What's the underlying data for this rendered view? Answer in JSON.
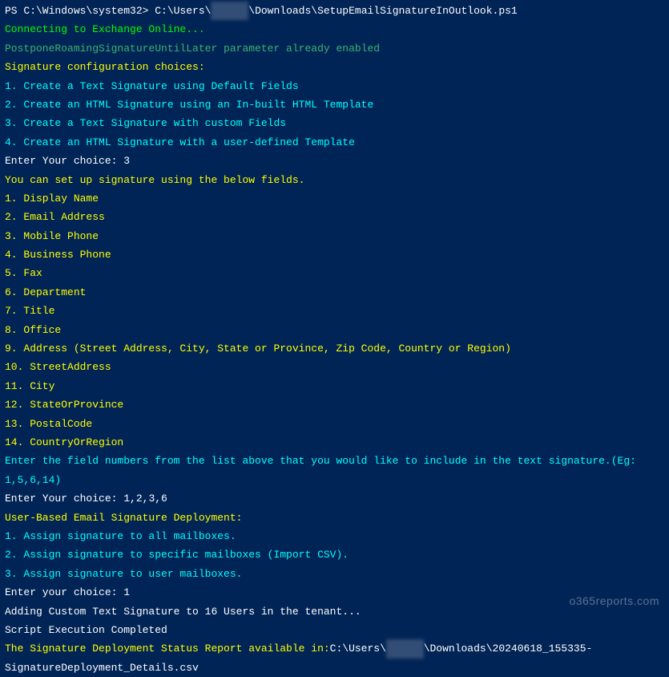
{
  "prompt": {
    "prefix": "PS C:\\Windows\\system32> C:\\Users\\",
    "blurred": "xxxxxx",
    "suffix": "\\Downloads\\SetupEmailSignatureInOutlook.ps1"
  },
  "connecting": "Connecting to Exchange Online...",
  "postpone": "PostponeRoamingSignatureUntilLater parameter already enabled",
  "sigConfigHeader": "Signature configuration choices:",
  "sigOptions": [
    "1. Create a Text Signature using Default Fields",
    "2. Create an HTML Signature using an In-built HTML Template",
    "3. Create a Text Signature with custom Fields",
    "4. Create an HTML Signature with a user-defined Template"
  ],
  "enterChoice1": {
    "label": "Enter Your choice: ",
    "value": "3"
  },
  "fieldsHeader": "You can set up signature using the below fields.",
  "fields": [
    "1. Display Name",
    "2. Email Address",
    "3. Mobile Phone",
    "4. Business Phone",
    "5. Fax",
    "6. Department",
    "7. Title",
    "8. Office",
    "9. Address (Street Address, City, State or Province, Zip Code, Country or Region)",
    "10. StreetAddress",
    "11. City",
    "12. StateOrProvince",
    "13. PostalCode",
    "14. CountryOrRegion"
  ],
  "enterFieldNumbers": "Enter the field numbers from the list above that you would like to include in the text signature.(Eg: 1,5,6,14)",
  "enterChoice2": {
    "label": "Enter Your choice: ",
    "value": "1,2,3,6"
  },
  "deploymentHeader": "User-Based Email Signature Deployment:",
  "deploymentOptions": [
    "1. Assign signature to all mailboxes.",
    "2. Assign signature to specific mailboxes (Import CSV).",
    "3. Assign signature to user mailboxes."
  ],
  "enterChoice3": {
    "label": "Enter your choice: ",
    "value": "1"
  },
  "adding": "Adding Custom Text Signature to 16 Users in the tenant...",
  "completed": "Script Execution Completed",
  "report": {
    "prefix": "The Signature Deployment Status Report available in:",
    "path1": "C:\\Users\\",
    "blurred": "xxxxxx",
    "path2": "\\Downloads\\20240618_155335-SignatureDeployment_Details.csv"
  },
  "watermark": "o365reports.com"
}
